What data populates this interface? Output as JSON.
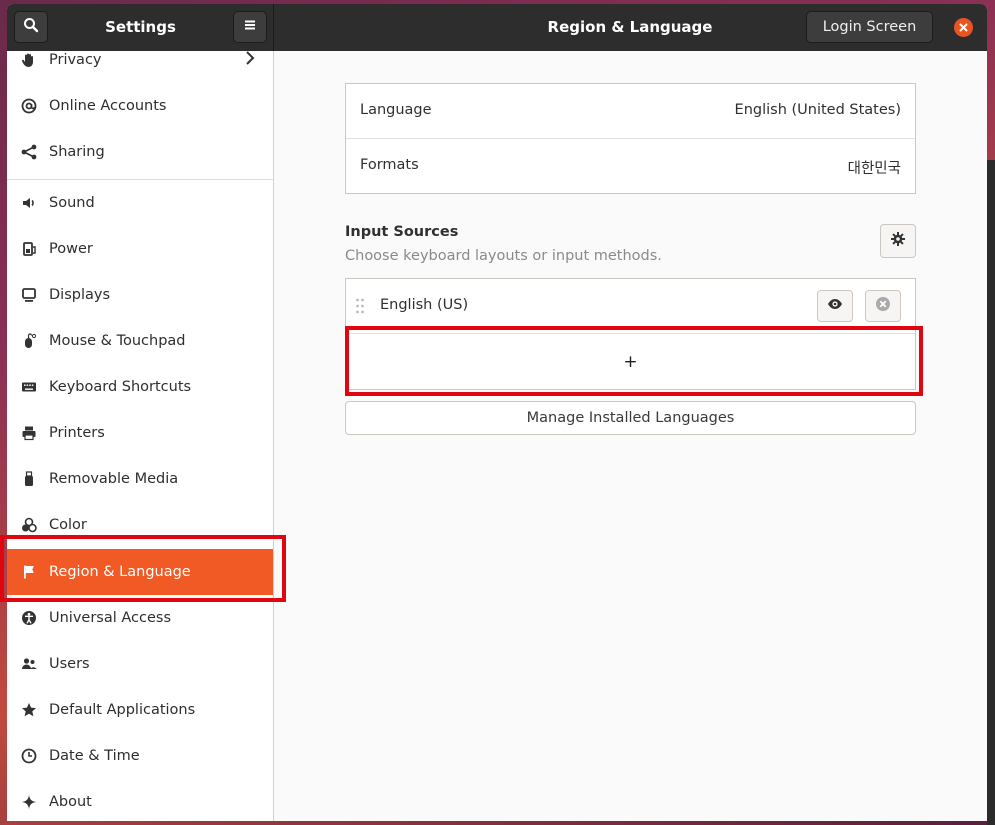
{
  "header": {
    "settings_title": "Settings",
    "page_title": "Region & Language",
    "login_screen_label": "Login Screen",
    "search_icon": "search-icon",
    "menu_icon": "hamburger-menu-icon",
    "close_icon": "close-icon"
  },
  "sidebar": {
    "items": [
      {
        "label": "Privacy",
        "icon": "hand-icon",
        "has_chevron": true
      },
      {
        "label": "Online Accounts",
        "icon": "at-icon"
      },
      {
        "label": "Sharing",
        "icon": "share-icon"
      },
      {
        "label": "Sound",
        "icon": "speaker-icon"
      },
      {
        "label": "Power",
        "icon": "power-icon"
      },
      {
        "label": "Displays",
        "icon": "display-icon"
      },
      {
        "label": "Mouse & Touchpad",
        "icon": "mouse-icon"
      },
      {
        "label": "Keyboard Shortcuts",
        "icon": "keyboard-icon"
      },
      {
        "label": "Printers",
        "icon": "printer-icon"
      },
      {
        "label": "Removable Media",
        "icon": "usb-icon"
      },
      {
        "label": "Color",
        "icon": "color-icon"
      },
      {
        "label": "Region & Language",
        "icon": "flag-icon",
        "active": true
      },
      {
        "label": "Universal Access",
        "icon": "accessibility-icon"
      },
      {
        "label": "Users",
        "icon": "users-icon"
      },
      {
        "label": "Default Applications",
        "icon": "star-icon"
      },
      {
        "label": "Date & Time",
        "icon": "clock-icon"
      },
      {
        "label": "About",
        "icon": "sparkle-icon"
      }
    ]
  },
  "main": {
    "language_label": "Language",
    "language_value": "English (United States)",
    "formats_label": "Formats",
    "formats_value": "대한민국",
    "input_sources_title": "Input Sources",
    "input_sources_subtitle": "Choose keyboard layouts or input methods.",
    "input_source": "English (US)",
    "add_label": "+",
    "manage_languages_label": "Manage Installed Languages"
  },
  "colors": {
    "accent": "#f15a24",
    "headerbar": "#2d2d2d",
    "highlight": "#e0060f"
  }
}
